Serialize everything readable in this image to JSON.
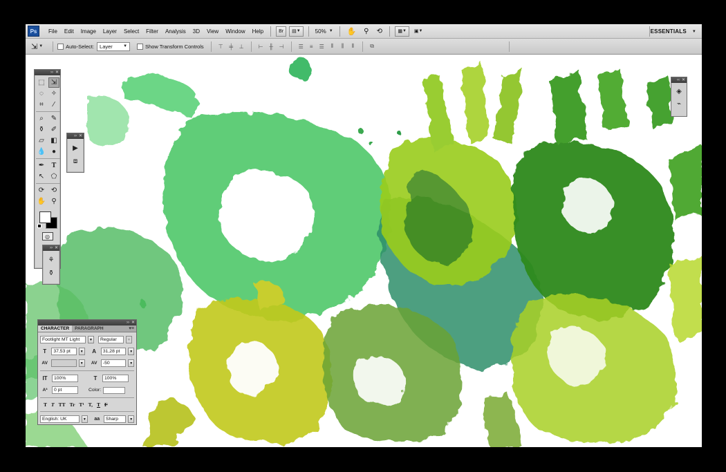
{
  "app": {
    "logo": "Ps",
    "menus": [
      "File",
      "Edit",
      "Image",
      "Layer",
      "Select",
      "Filter",
      "Analysis",
      "3D",
      "View",
      "Window",
      "Help"
    ],
    "bridge_label": "Br",
    "zoom": "50%",
    "workspace": "ESSENTIALS"
  },
  "options": {
    "auto_select_label": "Auto-Select:",
    "auto_select_value": "Layer",
    "show_transform_label": "Show Transform Controls"
  },
  "character": {
    "tabs": [
      "CHARACTER",
      "PARAGRAPH"
    ],
    "font_family": "Footlight MT Light",
    "font_style": "Regular",
    "font_size": "37,53 pt",
    "leading": "31,28 pt",
    "kerning": "",
    "tracking": "-50",
    "vertical_scale": "100%",
    "horizontal_scale": "100%",
    "baseline_shift": "0 pt",
    "color_label": "Color:",
    "type_styles": [
      "T",
      "T",
      "TT",
      "Tr",
      "T¹",
      "T,",
      "T",
      "F"
    ],
    "language": "English: UK",
    "antialias_icon": "aa",
    "antialias": "Sharp"
  },
  "colors": {
    "foreground": "#ffffff",
    "background": "#000000",
    "chrome": "#d4d4d4"
  },
  "icons": [
    "move-tool-icon",
    "marquee-icon",
    "lasso-icon",
    "magic-wand-icon",
    "crop-icon",
    "eyedropper-icon",
    "healing-brush-icon",
    "brush-icon",
    "clone-stamp-icon",
    "history-brush-icon",
    "eraser-icon",
    "gradient-icon",
    "blur-icon",
    "dodge-icon",
    "pen-icon",
    "type-icon",
    "path-selection-icon",
    "shape-icon",
    "3d-rotate-icon",
    "3d-orbit-icon",
    "hand-icon",
    "zoom-icon",
    "layers-icon",
    "paths-icon"
  ]
}
